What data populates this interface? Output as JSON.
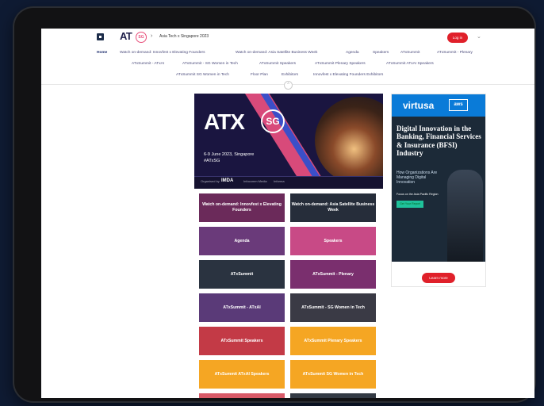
{
  "header": {
    "brand": "AT",
    "brand_badge": "SG",
    "breadcrumb": "Asia Tech x Singapore 2023",
    "login_label": "Log in"
  },
  "nav": {
    "row1": [
      "Home",
      "Watch on-demand: Innovfest x Elevating Founders",
      "Watch on-demand: Asia Satellite Business Week",
      "Agenda",
      "Speakers",
      "ATxSummit",
      "ATxSummit - Plenary"
    ],
    "row2": [
      "ATxSummit - ATxAI",
      "ATxSummit - SG Women in Tech",
      "ATxSummit Speakers",
      "ATxSummit Plenary Speakers",
      "ATxSummit ATxAI Speakers"
    ],
    "row3": [
      "ATxSummit SG Women in Tech",
      "Floor Plan",
      "Exhibitors",
      "Innovfest x Elevating Founders Exhibitors"
    ]
  },
  "banner": {
    "title": "ATX",
    "badge": "SG",
    "date": "6-9 June 2023, Singapore",
    "hashtag": "#ATxSG",
    "sponsors": [
      "Organised by",
      "IMDA",
      "Infocomm Media",
      "Informa"
    ]
  },
  "tiles": [
    {
      "label": "Watch on-demand: Innovfest x Elevating Founders",
      "color": "#6b2a5a"
    },
    {
      "label": "Watch on-demand: Asia Satellite Business Week",
      "color": "#262d3a"
    },
    {
      "label": "Agenda",
      "color": "#6a3a7a"
    },
    {
      "label": "Speakers",
      "color": "#c84a86"
    },
    {
      "label": "ATxSummit",
      "color": "#2a3340"
    },
    {
      "label": "ATxSummit - Plenary",
      "color": "#7a2f6e"
    },
    {
      "label": "ATxSummit - ATxAI",
      "color": "#5a3a78"
    },
    {
      "label": "ATxSummit - SG Women in Tech",
      "color": "#3a3a45"
    },
    {
      "label": "ATxSummit Speakers",
      "color": "#c33a46"
    },
    {
      "label": "ATxSummit Plenary Speakers",
      "color": "#f5a623"
    },
    {
      "label": "ATxSummit ATxAI Speakers",
      "color": "#f5a623"
    },
    {
      "label": "ATxSummit SG Women in Tech",
      "color": "#f5a623"
    },
    {
      "label": "",
      "color": "#d85a68"
    },
    {
      "label": "",
      "color": "#333a44"
    }
  ],
  "ad": {
    "brand": "virtusa",
    "partner": "aws",
    "title": "Digital Innovation in the Banking, Financial Services & Insurance (BFSI) Industry",
    "subtitle": "How Organizations Are Managing Digital Innovation",
    "focus": "Focus on the Asia Pacific Region",
    "cta": "Get Your Report",
    "learn_more": "Learn more"
  }
}
